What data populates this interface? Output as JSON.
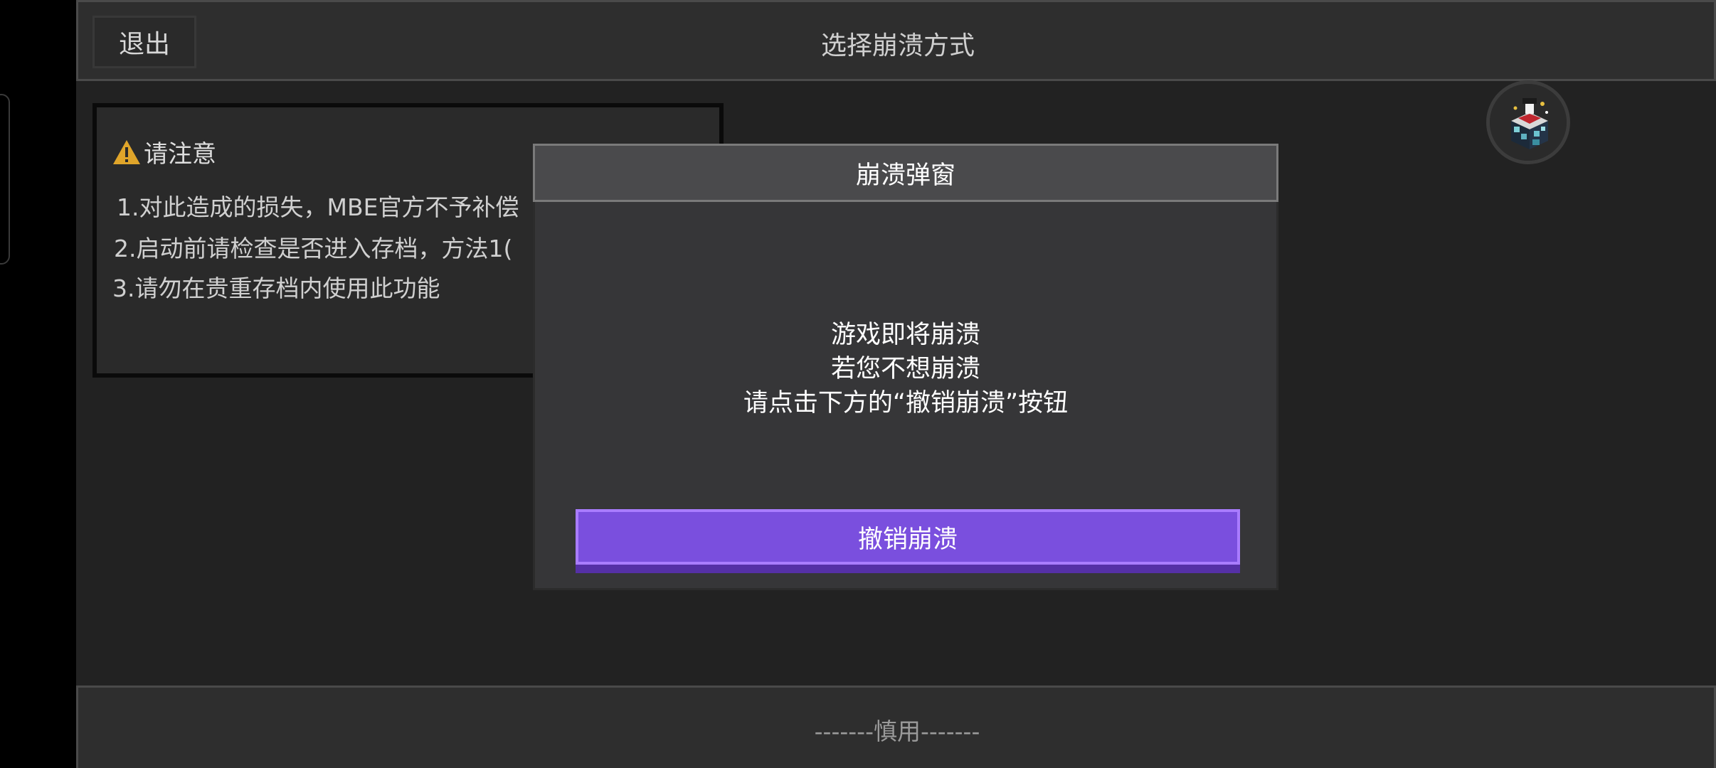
{
  "topbar": {
    "exit_label": "退出",
    "title": "选择崩溃方式"
  },
  "notice": {
    "title": "请注意",
    "lines": [
      "1.对此造成的损失，MBE官方不予补偿",
      "2.启动前请检查是否进入存档，方法1(",
      "3.请勿在贵重存档内使用此功能"
    ]
  },
  "dialog": {
    "title": "崩溃弹窗",
    "message": [
      "游戏即将崩溃",
      "若您不想崩溃",
      "请点击下方的“撤销崩溃”按钮"
    ],
    "cancel_label": "撤销崩溃"
  },
  "bottombar": {
    "label": "-------慎用-------"
  },
  "colors": {
    "accent": "#7a4fde",
    "accent_border": "#a97cff",
    "warning": "#e0a52a",
    "background": "#222222"
  },
  "icons": {
    "warning": "warning-icon",
    "avatar": "avatar-icon"
  }
}
